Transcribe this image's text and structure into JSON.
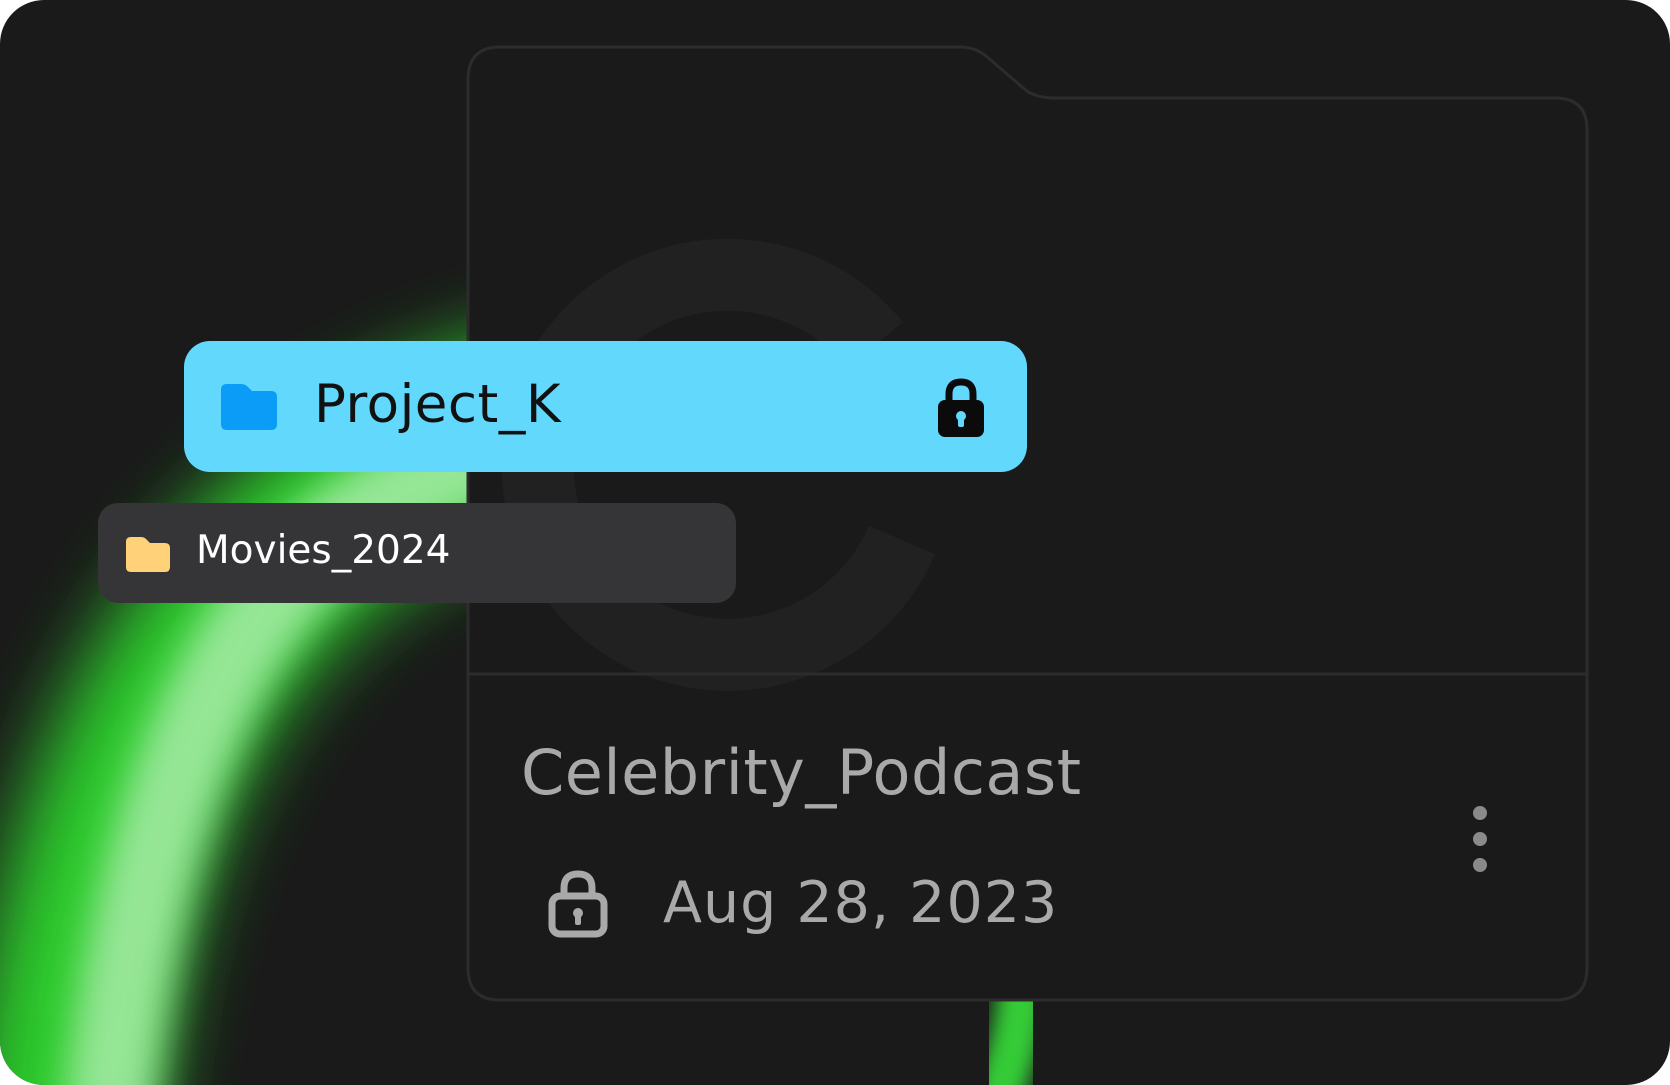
{
  "items": {
    "primary": {
      "name": "Project_K",
      "locked": true,
      "folder_color": "#0a9cf7"
    },
    "secondary": {
      "name": "Movies_2024",
      "folder_color": "#ffd27a"
    }
  },
  "card": {
    "name": "Celebrity_Podcast",
    "date": "Aug 28, 2023",
    "locked": true
  },
  "colors": {
    "background": "#1a1a1a",
    "highlight": "#62d8fc",
    "pill_dark": "#353537",
    "accent_glow": "#39e83a",
    "muted_text": "#a9a9a9"
  },
  "icons": {
    "primary_lead": "folder-icon",
    "primary_trail": "lock-icon",
    "secondary_lead": "folder-icon",
    "card_lock": "lock-icon",
    "card_menu": "more-vertical-icon"
  }
}
